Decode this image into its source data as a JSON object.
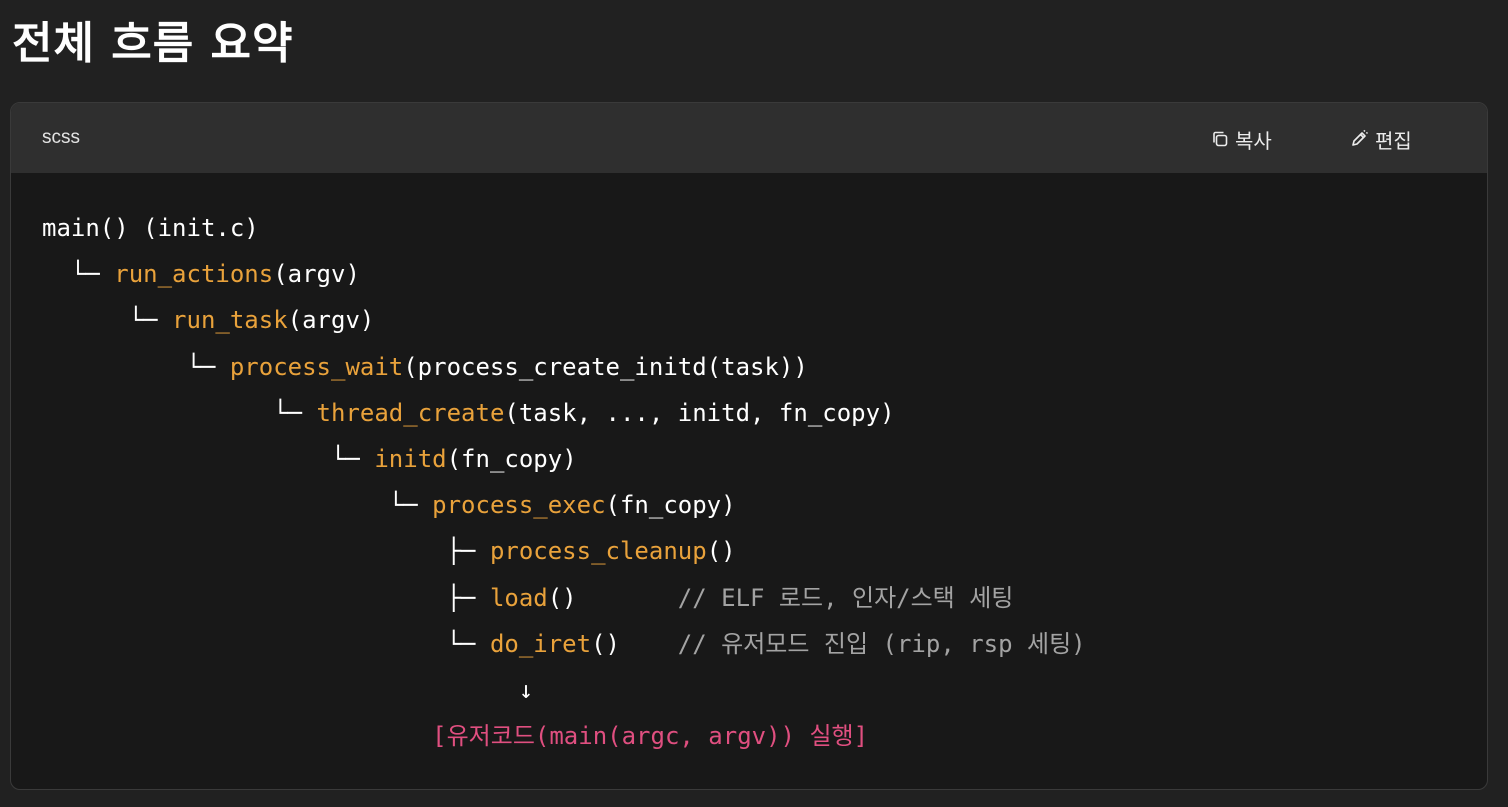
{
  "heading": "전체 흐름 요약",
  "code_block": {
    "language": "scss",
    "copy_label": "복사",
    "edit_label": "편집",
    "copy_icon": "copy-icon",
    "edit_icon": "pencil-icon",
    "colors": {
      "function": "#e9a23b",
      "comment": "#a3a3a3",
      "highlight": "#e04f80",
      "plain": "#ffffff"
    },
    "lines": [
      {
        "indent": "",
        "fn": "",
        "rest": "main() (init.c)",
        "comment": ""
      },
      {
        "indent": "  └─ ",
        "fn": "run_actions",
        "rest": "(argv)",
        "comment": ""
      },
      {
        "indent": "      └─ ",
        "fn": "run_task",
        "rest": "(argv)",
        "comment": ""
      },
      {
        "indent": "          └─ ",
        "fn": "process_wait",
        "rest": "(process_create_initd(task))",
        "comment": ""
      },
      {
        "indent": "                └─ ",
        "fn": "thread_create",
        "rest": "(task, ..., initd, fn_copy)",
        "comment": ""
      },
      {
        "indent": "                    └─ ",
        "fn": "initd",
        "rest": "(fn_copy)",
        "comment": ""
      },
      {
        "indent": "                        └─ ",
        "fn": "process_exec",
        "rest": "(fn_copy)",
        "comment": ""
      },
      {
        "indent": "                            ├─ ",
        "fn": "process_cleanup",
        "rest": "()",
        "comment": ""
      },
      {
        "indent": "                            ├─ ",
        "fn": "load",
        "rest": "()",
        "comment": "       // ELF 로드, 인자/스택 세팅"
      },
      {
        "indent": "                            └─ ",
        "fn": "do_iret",
        "rest": "()",
        "comment": "    // 유저모드 진입 (rip, rsp 세팅)"
      },
      {
        "indent": "                                 ",
        "fn": "",
        "rest": "↓",
        "comment": ""
      },
      {
        "indent": "                           ",
        "fn": "",
        "rest": "",
        "comment": "",
        "highlight": "[유저코드(main(argc, argv)) 실행]"
      }
    ]
  }
}
